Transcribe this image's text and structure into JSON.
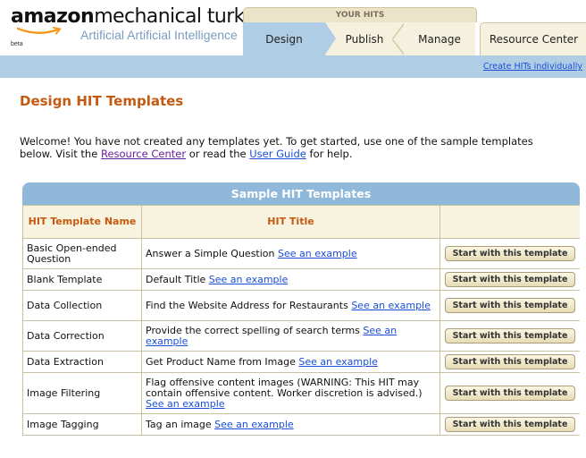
{
  "header": {
    "logo_bold": "amazon",
    "logo_light": "mechanical turk",
    "logo_tagline": "Artificial Artificial Intelligence",
    "logo_beta": "beta",
    "your_hits_label": "YOUR HITS",
    "tabs": [
      {
        "label": "Design"
      },
      {
        "label": "Publish"
      },
      {
        "label": "Manage"
      },
      {
        "label": "Resource Center"
      }
    ],
    "active_tab": "Design",
    "create_link": "Create HITs individually"
  },
  "main": {
    "title": "Design HIT Templates",
    "welcome_text_1": "Welcome! You have not created any templates yet. To get started, use one of the sample templates below. Visit the ",
    "resource_center_link": "Resource Center",
    "welcome_text_2": " or read the ",
    "user_guide_link": "User Guide",
    "welcome_text_3": " for help."
  },
  "templates": {
    "title": "Sample HIT Templates",
    "columns": [
      "HIT Template Name",
      "HIT Title",
      ""
    ],
    "button_label": "Start with this template",
    "example_link": "See an example",
    "rows": [
      {
        "name": "Basic Open-ended Question",
        "title": "Answer a Simple Question"
      },
      {
        "name": "Blank Template",
        "title": "Default Title"
      },
      {
        "name": "Data Collection",
        "title": "Find the Website Address for Restaurants"
      },
      {
        "name": "Data Correction",
        "title": "Provide the correct spelling of search terms"
      },
      {
        "name": "Data Extraction",
        "title": "Get Product Name from Image"
      },
      {
        "name": "Image Filtering",
        "title": "Flag offensive content images (WARNING: This HIT may contain offensive content. Worker discretion is advised.)"
      },
      {
        "name": "Image Tagging",
        "title": "Tag an image"
      }
    ]
  },
  "colors": {
    "accent_orange": "#c45a12",
    "nav_blue": "#b0cde6",
    "link_blue": "#1a4ed8"
  }
}
